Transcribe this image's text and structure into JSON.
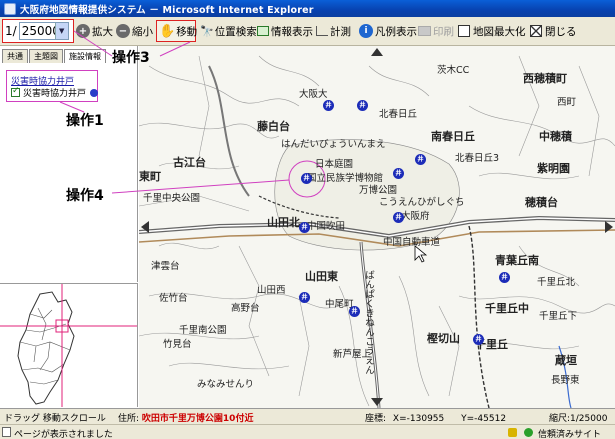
{
  "window": {
    "title": "大阪府地図情報提供システム － Microsoft Internet Explorer"
  },
  "toolbar": {
    "scale_prefix": "1/",
    "scale_value": "25000",
    "zoom_in": "拡大",
    "zoom_out": "縮小",
    "move": "移動",
    "position_search": "位置検索",
    "info_display": "情報表示",
    "measure": "計測",
    "legend": "凡例表示",
    "print": "印刷",
    "maximize": "地図最大化",
    "close": "閉じる"
  },
  "callouts": {
    "op1": "操作1",
    "op3": "操作3",
    "op4": "操作4"
  },
  "leftpanel": {
    "tabs": [
      "共通",
      "主題図",
      "施設情報"
    ],
    "active_tab": 2,
    "layer_group": "災害時協力井戸",
    "layer_item": "災害時協力井戸",
    "layer_checked": true
  },
  "map": {
    "labels": {
      "l1": "茨木CC",
      "l2": "西穂積町",
      "l3": "大阪大",
      "l4": "北春日丘",
      "l5": "藤白台",
      "l6": "はんだいびょういんまえ",
      "l7": "南春日丘",
      "l8": "中穂積",
      "l9": "古江台",
      "l10": "日本庭園",
      "l11": "紫明園",
      "l12": "東町",
      "l13": "国立民族学博物館",
      "l14": "万博公園",
      "l15": "千里中央公園",
      "l16": "こうえんひがしぐち",
      "l17": "穂積台",
      "l18": "中国吹田",
      "l19": "大阪府",
      "l20": "山田北",
      "l21": "中国自動車道",
      "l22": "津雲台",
      "l23": "山田東",
      "l24": "青葉丘南",
      "l25": "千里丘北",
      "l26": "千里丘中",
      "l27": "樫切山",
      "l28": "千里丘",
      "l29": "蔵垣",
      "l30": "長野東",
      "l31": "竹見台",
      "l32": "みなみせんり",
      "l33": "高野台",
      "l34": "佐竹台",
      "l35": "千里南公園",
      "l36": "山田西",
      "l37": "中尾町",
      "l38": "新芦屋上",
      "l39": "千里丘下",
      "l40": "北春日丘3",
      "l41": "西町",
      "l42": "ばんぱくきねんこうえん"
    }
  },
  "statusbar": {
    "drag": "ドラッグ 移動スクロール",
    "address_label": "住所:",
    "address_value": "吹田市千里万博公園10付近",
    "coord_label": "座標:",
    "x_label": "X=",
    "x_value": "-130955",
    "y_label": "Y=",
    "y_value": "-45512",
    "scale": "縮尺:1/25000"
  },
  "iestatus": {
    "done": "ページが表示されました",
    "zone": "信頼済みサイト"
  },
  "colors": {
    "callout_border": "#dd2222",
    "layer_border": "#d040c0",
    "marker": "#1c2cb8",
    "address_value": "#cc0000"
  }
}
